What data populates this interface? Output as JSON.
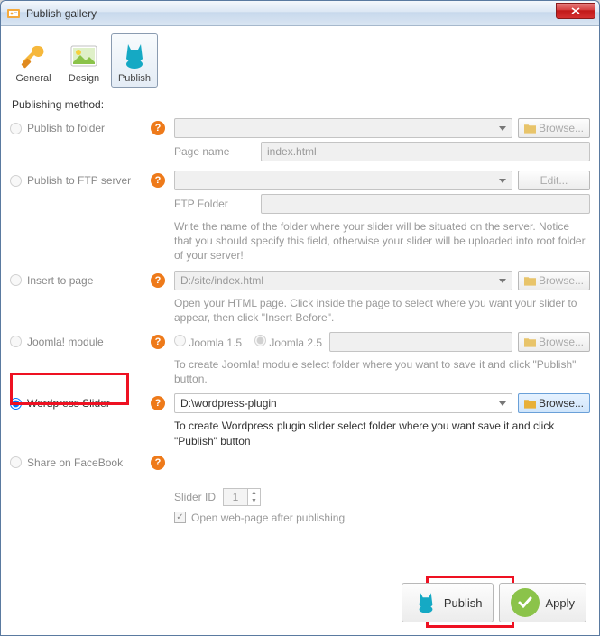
{
  "window": {
    "title": "Publish gallery"
  },
  "tabs": {
    "general": "General",
    "design": "Design",
    "publish": "Publish"
  },
  "section_title": "Publishing method:",
  "methods": {
    "folder": {
      "label": "Publish to folder",
      "browse": "Browse...",
      "page_name_label": "Page name",
      "page_name_value": "index.html"
    },
    "ftp": {
      "label": "Publish to FTP server",
      "edit": "Edit...",
      "ftp_folder_label": "FTP Folder",
      "desc": "Write the name of the folder where your slider will be situated on the server. Notice that you should specify this field, otherwise your slider will be uploaded into root folder of your server!"
    },
    "insert": {
      "label": "Insert to page",
      "value": "D:/site/index.html",
      "browse": "Browse...",
      "desc": "Open your HTML page. Click inside the page to select where you want your slider to appear, then click \"Insert Before\"."
    },
    "joomla": {
      "label": "Joomla! module",
      "j15": "Joomla 1.5",
      "j25": "Joomla 2.5",
      "browse": "Browse...",
      "desc": "To create Joomla! module select folder where you want to save it and click \"Publish\" button."
    },
    "wordpress": {
      "label": "Wordpress Slider",
      "value": "D:\\wordpress-plugin",
      "browse": "Browse...",
      "desc": "To create Wordpress plugin slider select folder where you want save it and click \"Publish\" button"
    },
    "facebook": {
      "label": "Share on FaceBook"
    }
  },
  "slider_id": {
    "label": "Slider ID",
    "value": "1"
  },
  "open_after": {
    "label": "Open web-page after publishing"
  },
  "footer": {
    "publish": "Publish",
    "apply": "Apply"
  }
}
